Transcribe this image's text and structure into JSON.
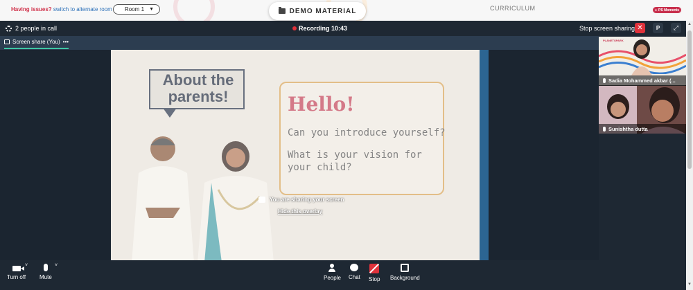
{
  "topbar": {
    "issues_text": "Having issues?",
    "alt_room_link": "switch to alternate room",
    "room_select": "Room 1",
    "demo_material": "DEMO MATERIAL",
    "curriculum": "CURRICULUM",
    "ps_badge": "PS Moments"
  },
  "call": {
    "people_count": "2 people in call",
    "recording": "Recording 10:43",
    "stop_sharing": "Stop screen sharing",
    "p_button": "P",
    "share_tab": "Screen share (You)",
    "share_tab_more": "•••"
  },
  "slide": {
    "about": "About the parents!",
    "hello": "Hello!",
    "q1": "Can you introduce yourself?",
    "q2": "What is your vision for your child?"
  },
  "overlay": {
    "message": "You are sharing your screen",
    "hide": "Hide this overlay"
  },
  "participants": [
    {
      "name": "Sadia Mohammed akbar (..."
    },
    {
      "name": "Sunishtha dutta"
    }
  ],
  "tile_logo": "PLANETSPARK",
  "controls": {
    "turn_off": "Turn off",
    "mute": "Mute",
    "people": "People",
    "chat": "Chat",
    "stop": "Stop",
    "background": "Background"
  },
  "colors": {
    "call_bg": "#1e2833",
    "record_red": "#e0323b",
    "accent_teal": "#3ec7a5",
    "hello_red": "#c4465a"
  }
}
